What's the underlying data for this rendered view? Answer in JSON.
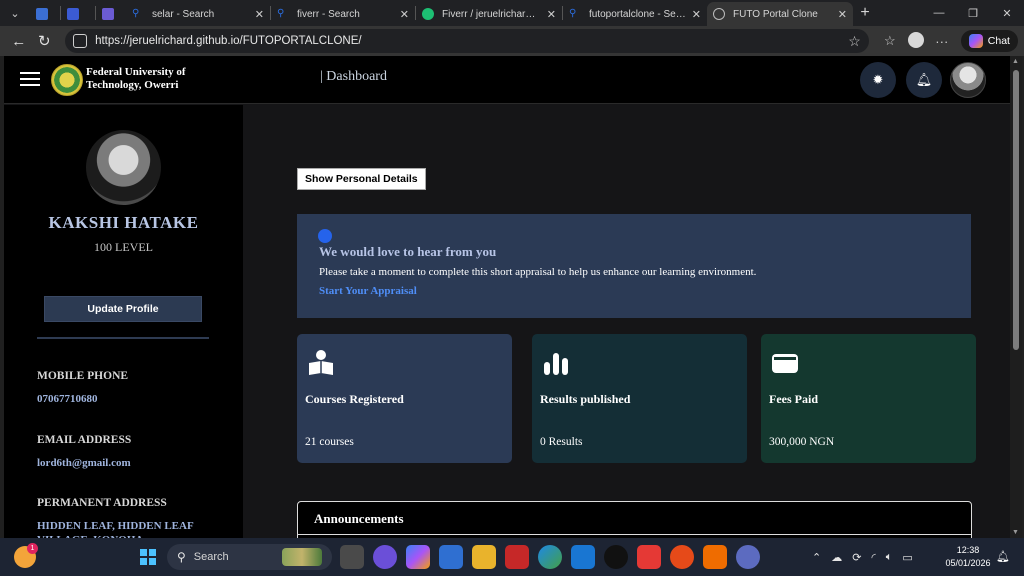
{
  "browser": {
    "tabs": [
      {
        "label": "",
        "icon": "#3b6fd4",
        "active": false
      },
      {
        "label": "",
        "icon": "#3b5bd4",
        "active": false
      },
      {
        "label": "",
        "icon": "#6b5bd4",
        "active": false
      },
      {
        "label": "selar - Search",
        "icon": "#2b6de0",
        "active": false
      },
      {
        "label": "fiverr - Search",
        "icon": "#2b6de0",
        "active": false
      },
      {
        "label": "Fiverr / jeruelrichard / Ed",
        "icon": "#1dbf73",
        "active": false
      },
      {
        "label": "futoportalclone - Search",
        "icon": "#2b6de0",
        "active": false
      },
      {
        "label": "FUTO Portal Clone",
        "icon": "#888888",
        "active": true
      }
    ],
    "url": "https://jeruelrichard.github.io/FUTOPORTALCLONE/",
    "chat_label": "Chat"
  },
  "header": {
    "university_name": "Federal University of Technology, Owerri",
    "page_title": "| Dashboard"
  },
  "profile": {
    "name": "KAKSHI HATAKE",
    "level": "100 LEVEL",
    "update_label": "Update Profile",
    "fields": [
      {
        "label": "MOBILE PHONE",
        "value": "07067710680"
      },
      {
        "label": "EMAIL ADDRESS",
        "value": "lord6th@gmail.com"
      },
      {
        "label": "PERMANENT ADDRESS",
        "value": "HIDDEN LEAF, HIDDEN LEAF VILLAGE, KONOHA"
      }
    ]
  },
  "main": {
    "show_details_label": "Show Personal Details",
    "appraisal": {
      "heading": "We would love to hear from you",
      "text": "Please take a moment to complete this short appraisal to help us enhance our learning environment.",
      "link": "Start Your Appraisal"
    },
    "cards": [
      {
        "title": "Courses Registered",
        "value": "21 courses",
        "color": "#2b3a55",
        "icon": "student-icon"
      },
      {
        "title": "Results published",
        "value": "0 Results",
        "color": "#142e36",
        "icon": "bar-chart-icon"
      },
      {
        "title": "Fees Paid",
        "value": "300,000 NGN",
        "color": "#14382f",
        "icon": "wallet-icon"
      }
    ],
    "announcements_title": "Announcements"
  },
  "taskbar": {
    "search_label": "Search",
    "weather_badge": "1",
    "time": "12:38",
    "date": "05/01/2026"
  }
}
